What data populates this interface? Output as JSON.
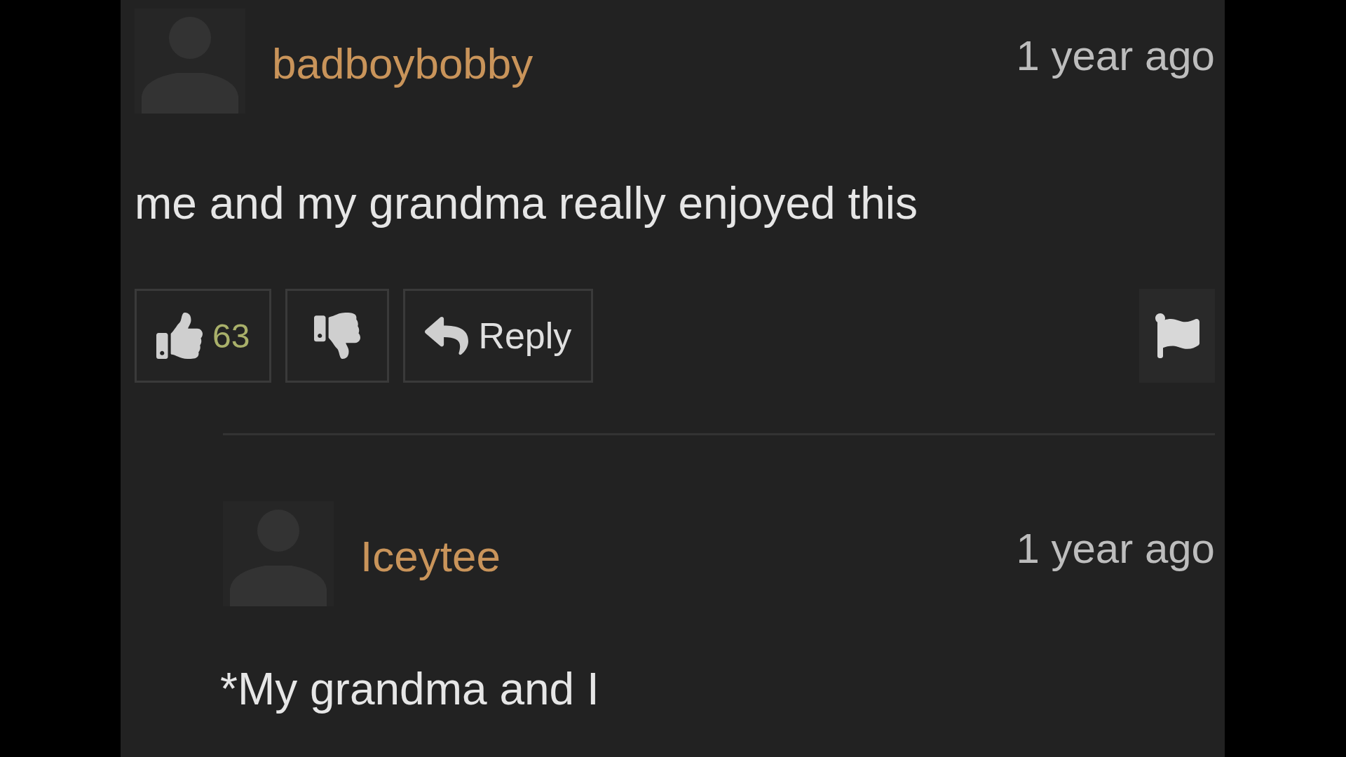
{
  "comments": [
    {
      "username": "badboybobby",
      "time": "1 year ago",
      "text": "me and my grandma really enjoyed this",
      "likes": "63",
      "reply_label": "Reply",
      "children": [
        {
          "username": "Iceytee",
          "time": "1 year ago",
          "text": "*My grandma and I"
        }
      ]
    }
  ]
}
